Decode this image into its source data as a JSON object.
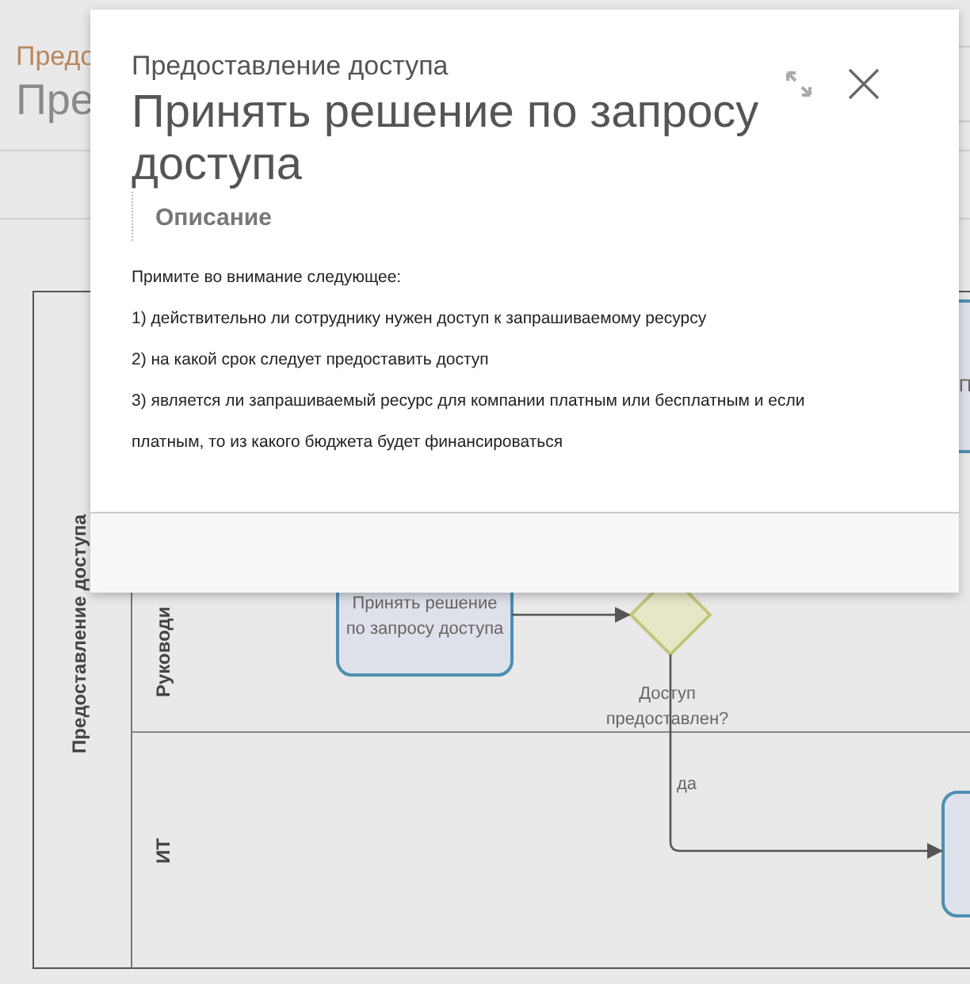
{
  "page_header": {
    "subtitle": "Предо",
    "title": "Пре"
  },
  "diagram": {
    "pool_label": "Предоставление доступа",
    "lanes": [
      {
        "label": "Руководи"
      },
      {
        "label": "ИТ"
      }
    ],
    "nodes": [
      {
        "kind": "task",
        "lines": [
          "Принять решение",
          "по запросу доступа"
        ]
      },
      {
        "kind": "gateway",
        "lines": [
          "Доступ",
          "предоставлен?"
        ]
      },
      {
        "kind": "task",
        "lines": [
          "П"
        ]
      },
      {
        "kind": "task"
      }
    ],
    "edges": [
      {
        "label": "да"
      }
    ]
  },
  "modal": {
    "subtitle": "Предоставление доступа",
    "title": "Принять решение по запросу доступа",
    "section": "Описание",
    "paragraphs": [
      "Примите во внимание следующее:",
      "1) действительно ли сотруднику нужен доступ к запрашиваемому ресурсу",
      "2) на какой срок следует предоставить доступ",
      "3) является ли запрашиваемый ресурс для компании платным или бесплатным и если платным, то из какого бюджета будет финансироваться"
    ]
  }
}
